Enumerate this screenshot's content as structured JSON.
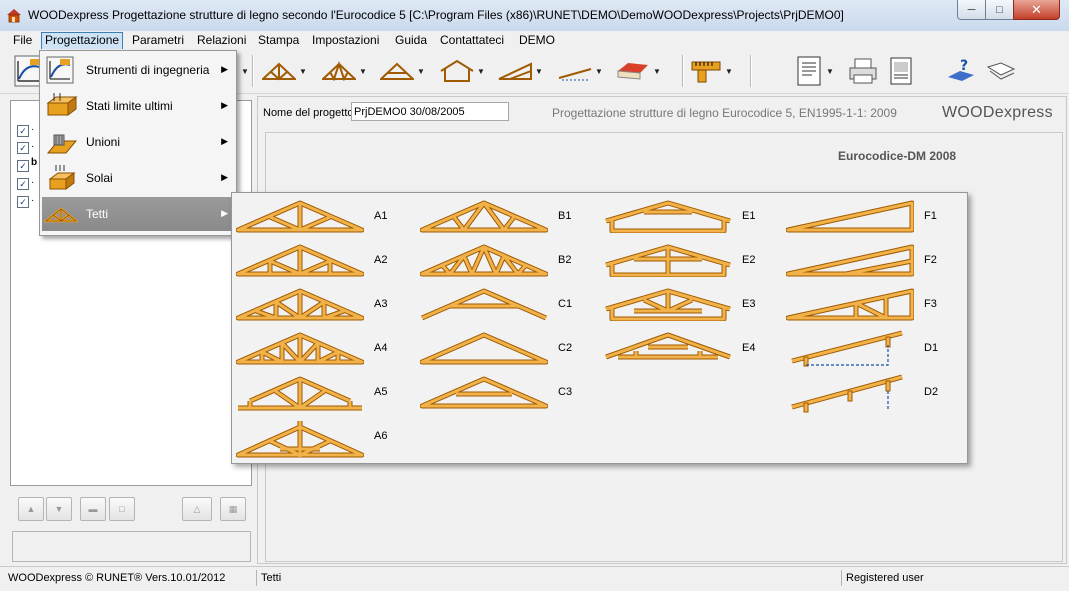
{
  "window": {
    "app_name": "WOODexpress",
    "title": "WOODexpress  Progettazione strutture di legno secondo l'Eurocodice 5  [C:\\Program Files (x86)\\RUNET\\DEMO\\DemoWOODexpress\\Projects\\PrjDEMO0]",
    "controls": {
      "minimize": "─",
      "maximize": "□",
      "close": "✕"
    }
  },
  "menubar": {
    "items": [
      "File",
      "Progettazione",
      "Parametri",
      "Relazioni",
      "Stampa",
      "Impostazioni",
      "Guida",
      "Contattateci",
      "DEMO"
    ],
    "active": "Progettazione"
  },
  "toolbar": {
    "groups": [
      "truss-tools",
      "roof-tools",
      "measure",
      "print-tools",
      "help"
    ]
  },
  "dropdown": {
    "items": [
      {
        "label": "Strumenti di ingegneria",
        "icon": "engineering-tools-icon"
      },
      {
        "label": "Stati limite ultimi",
        "icon": "ultimate-limit-states-icon"
      },
      {
        "label": "Unioni",
        "icon": "joints-icon"
      },
      {
        "label": "Solai",
        "icon": "floors-icon"
      },
      {
        "label": "Tetti",
        "icon": "roof-truss-icon"
      }
    ],
    "highlighted": "Tetti"
  },
  "submenu": {
    "columns": [
      [
        "A1",
        "A2",
        "A3",
        "A4",
        "A5",
        "A6"
      ],
      [
        "B1",
        "B2",
        "C1",
        "C2",
        "C3"
      ],
      [
        "E1",
        "E2",
        "E3",
        "E4"
      ],
      [
        "F1",
        "F2",
        "F3",
        "D1",
        "D2"
      ]
    ]
  },
  "project": {
    "name_label": "Nome del progetto",
    "name_value": "PrjDEMO0  30/08/2005",
    "description": "Progettazione strutture di legno Eurocodice 5, EN1995-1-1: 2009",
    "app_brand": "WOODexpress",
    "code_label": "Eurocodice-DM 2008"
  },
  "tree": {
    "checked_count": 5
  },
  "statusbar": {
    "left": "WOODexpress  ©  RUNET®  Vers.10.01/2012",
    "middle": "Tetti",
    "right": "Registered user"
  },
  "colors": {
    "wood": "#e8a020",
    "wood_edge": "#a05a00",
    "selection": "#8e8e8e",
    "accent_blue": "#1a4fa8"
  }
}
